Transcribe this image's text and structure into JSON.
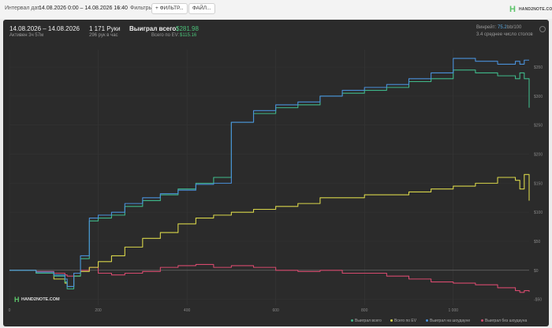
{
  "toolbar": {
    "interval_label": "Интервал дат:",
    "interval_value": "14.08.2026 0:00 – 14.08.2026 16:40",
    "filters_label": "Фильтры:",
    "filter_button": "+ ФИЛЬТР...",
    "file_button": "ФАЙЛ..."
  },
  "brand": {
    "logo_text": "HAND2NOTE.COM"
  },
  "header": {
    "date_range": "14.08.2026 – 14.08.2026",
    "active": "Активен 3ч 57м",
    "hands": "1 171 Руки",
    "hands_per_hour": "296 рук в час",
    "won_label": "Выиграл всего:",
    "won_value": "$281.98",
    "ev_label": "Всего по EV:",
    "ev_value": "$115.16",
    "winrate_label": "Винрейт:",
    "winrate_value": "75.2",
    "winrate_suffix": "bb/100",
    "avg_tables": "3.4 среднее число столов"
  },
  "legend": {
    "won": "Выиграл всего",
    "ev": "Всего по EV",
    "showdown": "Выиграл на шоудауне",
    "non_showdown": "Выиграл без шоудауна"
  },
  "colors": {
    "won": "#3fb98a",
    "ev": "#d8d54a",
    "showdown": "#4a90d9",
    "non_showdown": "#d64a6e",
    "accent_green": "#4bc17a"
  },
  "chart_data": {
    "type": "line",
    "x_ticks": [
      "0",
      "200",
      "400",
      "600",
      "800",
      "1 000"
    ],
    "y_ticks": [
      "$350",
      "$300",
      "$250",
      "$200",
      "$150",
      "$100",
      "$50",
      "$0",
      "-$50"
    ],
    "xlim": [
      0,
      1171
    ],
    "ylim": [
      -60,
      380
    ],
    "series": [
      {
        "name": "Выиграл всего",
        "x": [
          0,
          60,
          100,
          125,
          130,
          145,
          160,
          180,
          200,
          230,
          260,
          300,
          340,
          380,
          420,
          460,
          500,
          550,
          600,
          650,
          700,
          750,
          800,
          850,
          900,
          950,
          1000,
          1050,
          1100,
          1140,
          1150,
          1160,
          1171
        ],
        "y": [
          0,
          -5,
          -10,
          -20,
          -32,
          -10,
          20,
          85,
          90,
          95,
          110,
          120,
          130,
          140,
          150,
          160,
          255,
          270,
          280,
          285,
          300,
          305,
          310,
          315,
          325,
          330,
          345,
          340,
          335,
          330,
          340,
          330,
          280
        ]
      },
      {
        "name": "Всего по EV",
        "x": [
          0,
          60,
          100,
          125,
          130,
          145,
          160,
          180,
          200,
          230,
          260,
          300,
          340,
          380,
          420,
          460,
          500,
          550,
          600,
          650,
          700,
          750,
          800,
          850,
          900,
          950,
          1000,
          1050,
          1100,
          1140,
          1150,
          1160,
          1171
        ],
        "y": [
          0,
          -5,
          -15,
          -22,
          -28,
          -10,
          -2,
          5,
          15,
          25,
          40,
          55,
          65,
          80,
          90,
          95,
          100,
          105,
          110,
          115,
          125,
          125,
          130,
          130,
          135,
          140,
          145,
          150,
          160,
          155,
          140,
          165,
          120
        ]
      },
      {
        "name": "Выиграл на шоудауне",
        "x": [
          0,
          60,
          100,
          125,
          130,
          145,
          160,
          180,
          200,
          230,
          260,
          300,
          340,
          380,
          420,
          460,
          500,
          550,
          600,
          650,
          700,
          750,
          800,
          850,
          900,
          950,
          1000,
          1050,
          1100,
          1140,
          1150,
          1160,
          1171
        ],
        "y": [
          0,
          -3,
          -8,
          -15,
          -28,
          -5,
          25,
          90,
          95,
          100,
          115,
          125,
          132,
          138,
          148,
          150,
          255,
          275,
          285,
          290,
          300,
          310,
          315,
          320,
          330,
          340,
          365,
          360,
          355,
          360,
          355,
          362,
          362
        ]
      },
      {
        "name": "Выиграл без шоудауна",
        "x": [
          0,
          60,
          100,
          125,
          130,
          145,
          160,
          180,
          200,
          230,
          260,
          300,
          340,
          380,
          420,
          460,
          500,
          550,
          600,
          650,
          700,
          750,
          800,
          850,
          900,
          950,
          1000,
          1050,
          1100,
          1140,
          1150,
          1160,
          1171
        ],
        "y": [
          0,
          -2,
          -5,
          -8,
          -10,
          -5,
          0,
          5,
          -5,
          -8,
          -5,
          -2,
          5,
          8,
          10,
          5,
          8,
          5,
          0,
          -2,
          0,
          -5,
          -5,
          -10,
          -15,
          -20,
          -22,
          -25,
          -30,
          -35,
          -38,
          -35,
          -37
        ]
      }
    ]
  }
}
